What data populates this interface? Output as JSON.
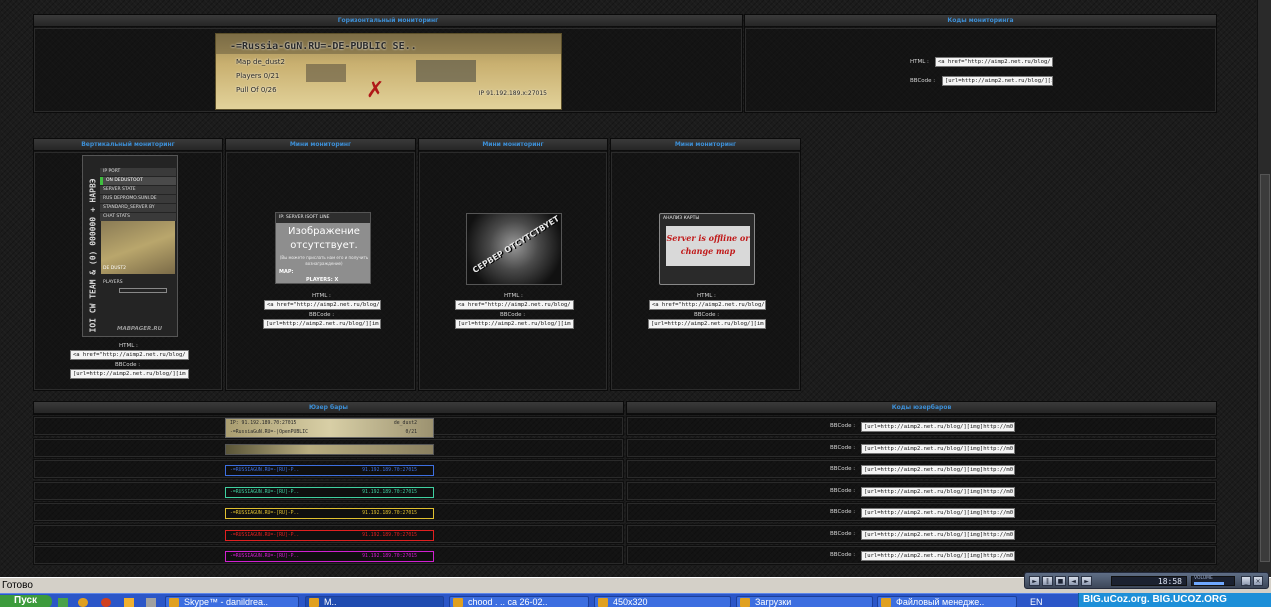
{
  "panels": {
    "horizontal": {
      "title": "Горизонтальный мониторинг"
    },
    "codes": {
      "title": "Коды мониторинга",
      "html_label": "HTML :",
      "bbcode_label": "BBCode :",
      "html_code": "<a href=\"http://aimp2.net.ru/blog/",
      "bbcode_code": "[url=http://aimp2.net.ru/blog/][i"
    },
    "vertical": {
      "title": "Вертикальный мониторинг",
      "html_label": "HTML :",
      "bbcode_label": "BBCode :",
      "html_code": "<a href=\"http://aimp2.net.ru/blog/",
      "bbcode_code": "[url=http://aimp2.net.ru/blog/][im"
    },
    "mini1": {
      "title": "Мини мониторинг",
      "html_label": "HTML :",
      "bbcode_label": "BBCode :",
      "html_code": "<a href=\"http://aimp2.net.ru/blog/",
      "bbcode_code": "[url=http://aimp2.net.ru/blog/][im"
    },
    "mini2": {
      "title": "Мини мониторинг",
      "html_label": "HTML :",
      "bbcode_label": "BBCode :",
      "html_code": "<a href=\"http://aimp2.net.ru/blog/",
      "bbcode_code": "[url=http://aimp2.net.ru/blog/][im"
    },
    "mini3": {
      "title": "Мини мониторинг",
      "html_label": "HTML :",
      "bbcode_label": "BBCode :",
      "html_code": "<a href=\"http://aimp2.net.ru/blog/",
      "bbcode_code": "[url=http://aimp2.net.ru/blog/][im"
    },
    "userbars": {
      "title": "Юзер бары"
    },
    "userbar_codes": {
      "title": "Коды юзербаров"
    }
  },
  "banner": {
    "title": "-=Russia-GuN.RU=-DE-PUBLIC SE..",
    "map_line": "Map de_dust2",
    "players_line": "Players 0/21",
    "ip_line": "Pull Of 0/26",
    "ip_addr": "IP 91.192.189.x:27015"
  },
  "vertical_monitor": {
    "side_text": "IOI CW TEAM & (0) 000000 + НАРВЭ",
    "rows": [
      "IP PORT",
      "ON DEDUSTOOT",
      "SERVER STATE",
      "RUS DEPROMO.SUNI.DE",
      "STANDARD_SERVER BY",
      "CHAT STATS"
    ],
    "map_label": "DE DUST2",
    "players_label": "PLAYERS",
    "footer": "MABPAGER.RU"
  },
  "mini_monitors": {
    "m1_header": "IP: SERVER ISOFT LINE",
    "m1_text": "Изображение отсутствует.",
    "m1_sub": "(Вы можете прислать нам его и получить вознаграждение)",
    "m1_map": "MAP:",
    "m1_players": "PLAYERS: X",
    "m2_text": "CEPBEP OTCYTCTBYET",
    "m3_header": "АНАЛИЗ КАРТЫ",
    "m3_text": "Server is offline or change map"
  },
  "userbar_rows": [
    {
      "left": "IP: 91.192.189.70:27015",
      "right": "de_dust2",
      "line2": "-=RussiaGuN.RU=-|OpenPUBLIC",
      "line2r": "0/21",
      "style": "photo",
      "color": "#c8c8a0",
      "bbcode_label": "BBCode :",
      "code": "[url=http://aimp2.net.ru/blog/][img]http://m0"
    },
    {
      "left": "",
      "right": "",
      "style": "photo2",
      "color": "#c8c8a0",
      "bbcode_label": "BBCode :",
      "code": "[url=http://aimp2.net.ru/blog/][img]http://m0"
    },
    {
      "left": "-=RUSSIAGUN.RU=-[RU]-P..",
      "right": "91.192.189.70:27015",
      "style": "plain",
      "color": "#3d6fe0",
      "bbcode_label": "BBCode :",
      "code": "[url=http://aimp2.net.ru/blog/][img]http://m0"
    },
    {
      "left": "-=RUSSIAGUN.RU=-[RU]-P..",
      "right": "91.192.189.70:27015",
      "style": "plain",
      "color": "#3fd0a0",
      "bbcode_label": "BBCode :",
      "code": "[url=http://aimp2.net.ru/blog/][img]http://m0"
    },
    {
      "left": "-=RUSSIAGUN.RU=-[RU]-P..",
      "right": "91.192.189.70:27015",
      "style": "plain",
      "color": "#e0c030",
      "bbcode_label": "BBCode :",
      "code": "[url=http://aimp2.net.ru/blog/][img]http://m0"
    },
    {
      "left": "-=RUSSIAGUN.RU=-[RU]-P..",
      "right": "91.192.189.70:27015",
      "style": "plain",
      "color": "#e02020",
      "bbcode_label": "BBCode :",
      "code": "[url=http://aimp2.net.ru/blog/][img]http://m0"
    },
    {
      "left": "-=RUSSIAGUN.RU=-[RU]-P..",
      "right": "91.192.189.70:27015",
      "style": "plain",
      "color": "#d020d0",
      "bbcode_label": "BBCode :",
      "code": "[url=http://aimp2.net.ru/blog/][img]http://m0"
    }
  ],
  "status_bar": {
    "text": "Готово"
  },
  "player": {
    "time": "18:58",
    "volume_label": "VOLUME"
  },
  "taskbar": {
    "start": "Пуск",
    "items": [
      "Skype™ - danildrea..",
      "M..",
      "chood . .. ca 26-02..",
      "450x320",
      "Загрузки",
      "Файловый менедже.."
    ],
    "lang": "EN",
    "tray_text": "BIG.uCoz.org. BIG.UCOZ.ORG",
    "clock": "10:16"
  },
  "colors": {
    "accent_title": "#3d8fd6",
    "page_bg": "#1c1c1c",
    "taskbar": "#2b56c8"
  }
}
